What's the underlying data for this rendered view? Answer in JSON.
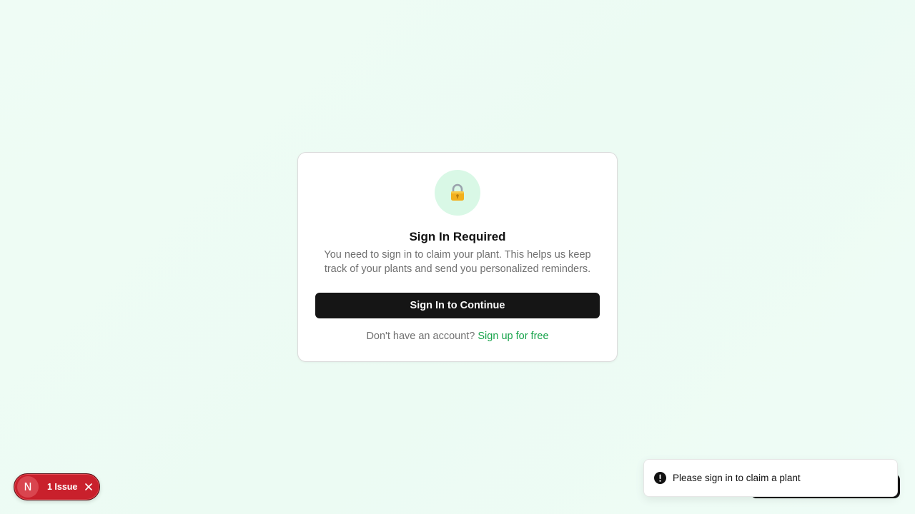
{
  "card": {
    "lock_icon": "lock-icon",
    "title": "Sign In Required",
    "description": "You need to sign in to claim your plant. This helps us keep track of your plants and send you personalized reminders.",
    "primary_button": "Sign In to Continue",
    "footer_text": "Don't have an account?",
    "footer_link": "Sign up for free"
  },
  "dev_overlay": {
    "logo_letter": "N",
    "issues_label": "1 Issue",
    "close_icon": "close-icon"
  },
  "toast": {
    "icon": "alert-circle-icon",
    "message": "Please sign in to claim a plant"
  },
  "colors": {
    "background": "#effcf5",
    "accent": "#16a34a",
    "lock_circle": "#d9f8e6",
    "primary_button": "#151515",
    "issue_pill": "#c9202c"
  }
}
